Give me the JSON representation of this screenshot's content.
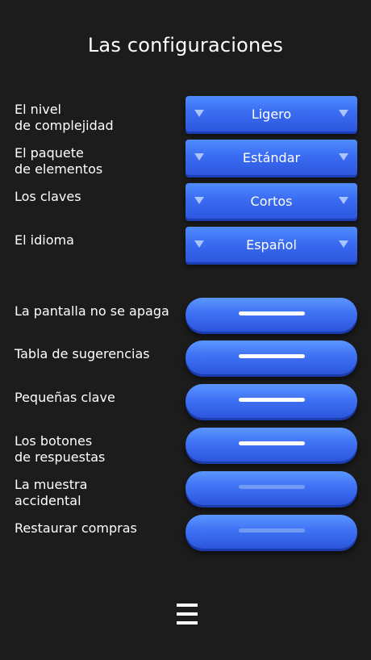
{
  "title": "Las configuraciones",
  "selects": [
    {
      "label": "El nivel\nde complejidad",
      "value": "Ligero"
    },
    {
      "label": "El paquete\nde elementos",
      "value": "Estándar"
    },
    {
      "label": "Los claves",
      "value": "Cortos"
    },
    {
      "label": "El idioma",
      "value": "Español"
    }
  ],
  "toggles": [
    {
      "label": "La pantalla no se apaga",
      "state": "on"
    },
    {
      "label": "Tabla de sugerencias",
      "state": "on"
    },
    {
      "label": "Pequeñas clave",
      "state": "on"
    },
    {
      "label": "Los botones\nde respuestas",
      "state": "on"
    },
    {
      "label": "La muestra\naccidental",
      "state": "off"
    },
    {
      "label": "Restaurar compras",
      "state": "off"
    }
  ],
  "colors": {
    "accent": "#3a6cf2",
    "background": "#1c1c1c"
  },
  "icons": {
    "select_arrow": "triangle-down-icon",
    "menu": "hamburger-menu-icon"
  }
}
